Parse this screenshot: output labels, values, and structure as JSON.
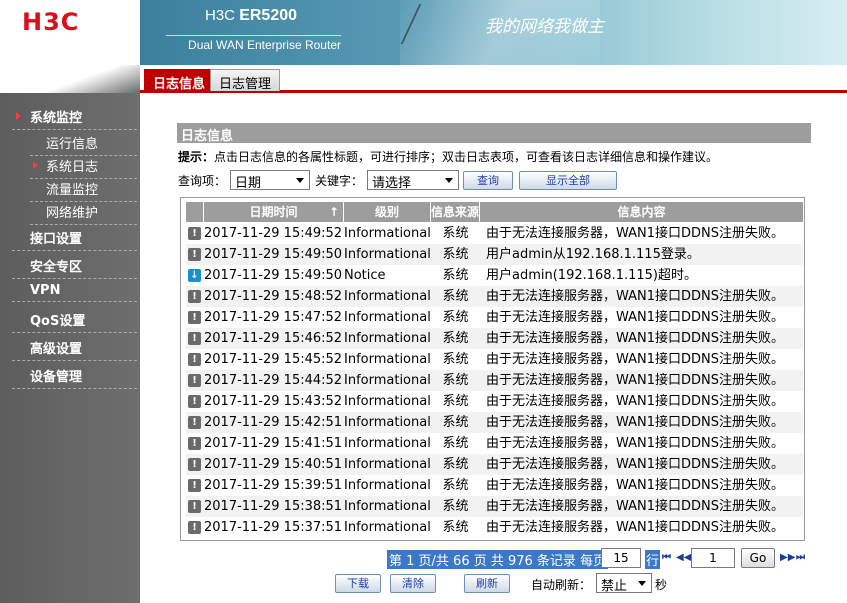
{
  "header": {
    "logo": "H3C",
    "product_prefix": "H3C",
    "product_model": "ER5200",
    "subtitle": "Dual WAN Enterprise Router",
    "slogan": "我的网络我做主"
  },
  "sidebar": {
    "items": [
      {
        "label": "系统监控"
      },
      {
        "label": "运行信息"
      },
      {
        "label": "系统日志"
      },
      {
        "label": "流量监控"
      },
      {
        "label": "网络维护"
      },
      {
        "label": "接口设置"
      },
      {
        "label": "安全专区"
      },
      {
        "label": "VPN"
      },
      {
        "label": "QoS设置"
      },
      {
        "label": "高级设置"
      },
      {
        "label": "设备管理"
      }
    ]
  },
  "tabs": [
    {
      "label": "日志信息"
    },
    {
      "label": "日志管理"
    }
  ],
  "section": {
    "title": "日志信息",
    "hint_label": "提示：",
    "hint_text": "点击日志信息的各属性标题，可进行排序；双击日志表项，可查看该日志详细信息和操作建议。"
  },
  "query": {
    "item_label": "查询项：",
    "item_value": "日期",
    "keyword_label": "关键字：",
    "keyword_value": "请选择",
    "search_button": "查询",
    "show_all_button": "显示全部"
  },
  "table": {
    "columns": [
      "日期时间",
      "级别",
      "信息来源",
      "信息内容"
    ],
    "sort_indicator": "↑",
    "rows": [
      {
        "time": "2017-11-29 15:49:52",
        "level": "Informational",
        "source": "系统",
        "msg": "由于无法连接服务器，WAN1接口DDNS注册失败。",
        "icon": "!"
      },
      {
        "time": "2017-11-29 15:49:50",
        "level": "Informational",
        "source": "系统",
        "msg": "用户admin从192.168.1.115登录。",
        "icon": "!"
      },
      {
        "time": "2017-11-29 15:49:50",
        "level": "Notice",
        "source": "系统",
        "msg": "用户admin(192.168.1.115)超时。",
        "icon": "↓"
      },
      {
        "time": "2017-11-29 15:48:52",
        "level": "Informational",
        "source": "系统",
        "msg": "由于无法连接服务器，WAN1接口DDNS注册失败。",
        "icon": "!"
      },
      {
        "time": "2017-11-29 15:47:52",
        "level": "Informational",
        "source": "系统",
        "msg": "由于无法连接服务器，WAN1接口DDNS注册失败。",
        "icon": "!"
      },
      {
        "time": "2017-11-29 15:46:52",
        "level": "Informational",
        "source": "系统",
        "msg": "由于无法连接服务器，WAN1接口DDNS注册失败。",
        "icon": "!"
      },
      {
        "time": "2017-11-29 15:45:52",
        "level": "Informational",
        "source": "系统",
        "msg": "由于无法连接服务器，WAN1接口DDNS注册失败。",
        "icon": "!"
      },
      {
        "time": "2017-11-29 15:44:52",
        "level": "Informational",
        "source": "系统",
        "msg": "由于无法连接服务器，WAN1接口DDNS注册失败。",
        "icon": "!"
      },
      {
        "time": "2017-11-29 15:43:52",
        "level": "Informational",
        "source": "系统",
        "msg": "由于无法连接服务器，WAN1接口DDNS注册失败。",
        "icon": "!"
      },
      {
        "time": "2017-11-29 15:42:51",
        "level": "Informational",
        "source": "系统",
        "msg": "由于无法连接服务器，WAN1接口DDNS注册失败。",
        "icon": "!"
      },
      {
        "time": "2017-11-29 15:41:51",
        "level": "Informational",
        "source": "系统",
        "msg": "由于无法连接服务器，WAN1接口DDNS注册失败。",
        "icon": "!"
      },
      {
        "time": "2017-11-29 15:40:51",
        "level": "Informational",
        "source": "系统",
        "msg": "由于无法连接服务器，WAN1接口DDNS注册失败。",
        "icon": "!"
      },
      {
        "time": "2017-11-29 15:39:51",
        "level": "Informational",
        "source": "系统",
        "msg": "由于无法连接服务器，WAN1接口DDNS注册失败。",
        "icon": "!"
      },
      {
        "time": "2017-11-29 15:38:51",
        "level": "Informational",
        "source": "系统",
        "msg": "由于无法连接服务器，WAN1接口DDNS注册失败。",
        "icon": "!"
      },
      {
        "time": "2017-11-29 15:37:51",
        "level": "Informational",
        "source": "系统",
        "msg": "由于无法连接服务器，WAN1接口DDNS注册失败。",
        "icon": "!"
      }
    ]
  },
  "pager": {
    "summary": "第 1 页/共 66 页 共 976 条记录 每页",
    "per_page": "15",
    "row_unit": "行",
    "page": "1",
    "go_button": "Go",
    "first_icon": "⏮",
    "prev_icon": "◀◀",
    "next_icon": "▶▶",
    "last_icon": "⏭"
  },
  "bottom": {
    "download_button": "下载",
    "clear_button": "清除",
    "refresh_button": "刷新",
    "auto_refresh_label": "自动刷新：",
    "auto_refresh_value": "禁止",
    "seconds_unit": "秒"
  },
  "colors": {
    "accent_red": "#c00000",
    "header_gray": "#9d9d9d",
    "sidebar_gray": "#666666",
    "pager_highlight": "#3b78c8"
  }
}
